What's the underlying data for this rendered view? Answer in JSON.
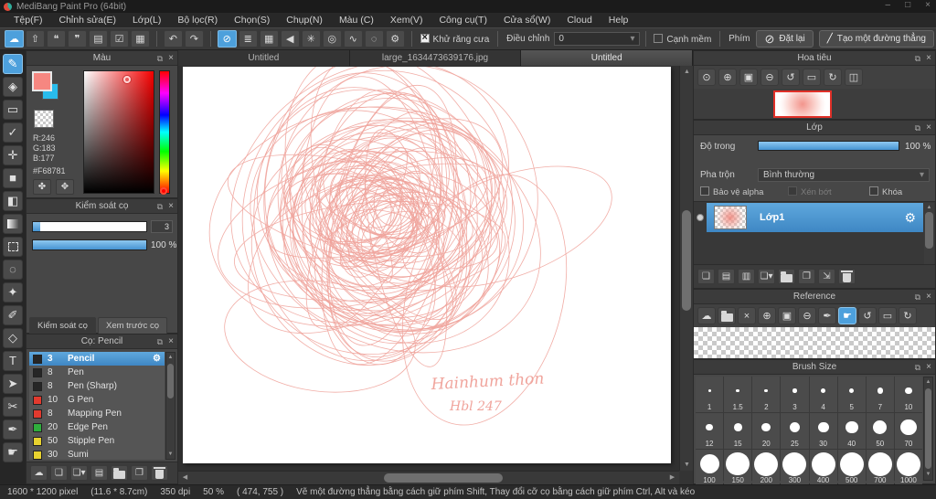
{
  "window": {
    "title": "MediBang Paint Pro (64bit)",
    "controls": {
      "minimize": "–",
      "maximize": "□",
      "close": "×"
    }
  },
  "menu": {
    "items": [
      "Tệp(F)",
      "Chỉnh sửa(E)",
      "Lớp(L)",
      "Bộ lọc(R)",
      "Chọn(S)",
      "Chụp(N)",
      "Màu (C)",
      "Xem(V)",
      "Công cụ(T)",
      "Cửa sổ(W)",
      "Cloud",
      "Help"
    ]
  },
  "toolbar": {
    "file_icons": [
      {
        "name": "cloud-icon",
        "glyph": "☁",
        "selected": true
      },
      {
        "name": "publish-icon",
        "glyph": "⇧"
      },
      {
        "name": "comment-icon",
        "glyph": "❝"
      },
      {
        "name": "chat-icon",
        "glyph": "❞"
      },
      {
        "name": "document-icon",
        "glyph": "▤"
      },
      {
        "name": "checklist-icon",
        "glyph": "☑"
      },
      {
        "name": "new-canvas-icon",
        "glyph": "▦"
      }
    ],
    "undo_icons": [
      {
        "name": "undo-icon",
        "glyph": "↶"
      },
      {
        "name": "redo-icon",
        "glyph": "↷"
      }
    ],
    "brushtip_icons": [
      {
        "name": "brushtip-none-icon",
        "glyph": "⊘",
        "selected": true
      },
      {
        "name": "brushtip-parallel-icon",
        "glyph": "≣"
      },
      {
        "name": "brushtip-mesh-icon",
        "glyph": "▦"
      },
      {
        "name": "brushtip-triangle-icon",
        "glyph": "◀"
      },
      {
        "name": "brushtip-radial-icon",
        "glyph": "✳"
      },
      {
        "name": "brushtip-concentric-icon",
        "glyph": "◎"
      },
      {
        "name": "brushtip-curve-icon",
        "glyph": "∿"
      },
      {
        "name": "brushtip-dashed-circle-icon",
        "glyph": "◌"
      },
      {
        "name": "brushtip-gear-icon",
        "glyph": "⚙"
      }
    ],
    "antialias_label": "Khử răng cưa",
    "adjust_label": "Điều chỉnh",
    "adjust_value": "0",
    "soft_edge_label": "Cạnh mềm",
    "key_label": "Phím",
    "reset_button": "Đặt lại",
    "line_button": "Tạo một đường thẳng"
  },
  "toolstrip": {
    "tools": [
      {
        "name": "brush-tool",
        "glyph": "✎",
        "selected": true
      },
      {
        "name": "eraser-tool",
        "glyph": "◈"
      },
      {
        "name": "shape-brush-tool",
        "glyph": "▭"
      },
      {
        "name": "dot-tool",
        "glyph": "✓"
      },
      {
        "name": "move-tool",
        "glyph": "✛"
      },
      {
        "name": "fill-rect-tool",
        "glyph": "■"
      },
      {
        "name": "bucket-tool",
        "glyph": "◧"
      },
      {
        "name": "gradient-tool",
        "shape": "gradient"
      },
      {
        "name": "select-tool",
        "shape": "dashed-box"
      },
      {
        "name": "lasso-tool",
        "glyph": "◌"
      },
      {
        "name": "magic-wand-tool",
        "glyph": "✦"
      },
      {
        "name": "select-pen-tool",
        "glyph": "✐"
      },
      {
        "name": "select-eraser-tool",
        "glyph": "◇"
      },
      {
        "name": "text-tool",
        "glyph": "T"
      },
      {
        "name": "operation-tool",
        "glyph": "➤"
      },
      {
        "name": "divide-tool",
        "glyph": "✂"
      },
      {
        "name": "eyedropper-tool",
        "glyph": "✒"
      },
      {
        "name": "hand-tool",
        "glyph": "☛"
      }
    ]
  },
  "color_panel": {
    "title": "Màu",
    "r_label": "R:246",
    "g_label": "G:183",
    "b_label": "B:177",
    "hex": "#F68781",
    "foreground_color": "#F68781",
    "background_color": "#29BCEC",
    "palette_icons": [
      {
        "name": "palette-icon",
        "glyph": "✤"
      },
      {
        "name": "palette-save-icon",
        "glyph": "✥"
      }
    ]
  },
  "brush_control": {
    "title": "Kiểm soát cọ",
    "size_value": "3",
    "opacity_value": "100 %",
    "tab_control": "Kiểm soát cọ",
    "tab_preview": "Xem trước cọ"
  },
  "brush_panel": {
    "title": "Cọ: Pencil",
    "brushes": [
      {
        "size": "3",
        "name": "Pencil",
        "swatch": "#262626",
        "selected": true
      },
      {
        "size": "8",
        "name": "Pen",
        "swatch": "#262626"
      },
      {
        "size": "8",
        "name": "Pen (Sharp)",
        "swatch": "#262626"
      },
      {
        "size": "10",
        "name": "G Pen",
        "swatch": "#e23a2e"
      },
      {
        "size": "8",
        "name": "Mapping Pen",
        "swatch": "#e23a2e"
      },
      {
        "size": "20",
        "name": "Edge Pen",
        "swatch": "#2fae3c"
      },
      {
        "size": "50",
        "name": "Stipple Pen",
        "swatch": "#e8d22f"
      },
      {
        "size": "30",
        "name": "Sumi",
        "swatch": "#e8d22f"
      }
    ],
    "footer_icons": [
      {
        "name": "cloud-brush-icon",
        "glyph": "☁"
      },
      {
        "name": "add-brush-icon",
        "glyph": "❏"
      },
      {
        "name": "add-brush-menu-icon",
        "glyph": "❏▾"
      },
      {
        "name": "brush-script-icon",
        "glyph": "▤"
      },
      {
        "name": "brush-folder-icon",
        "shape": "folder"
      },
      {
        "name": "duplicate-brush-icon",
        "glyph": "❐"
      },
      {
        "name": "delete-brush-icon",
        "shape": "trash"
      }
    ]
  },
  "tabs": [
    {
      "label": "Untitled",
      "active": false
    },
    {
      "label": "large_1634473639176.jpg",
      "active": false
    },
    {
      "label": "Untitled",
      "active": true
    }
  ],
  "canvas": {
    "stroke_color": "#f0a49c",
    "signature_line1": "Hainhum thon",
    "signature_line2": "Hbl 247"
  },
  "navigator": {
    "title": "Hoa tiêu",
    "icons": [
      {
        "name": "zoom-original-icon",
        "glyph": "⊙"
      },
      {
        "name": "zoom-in-icon",
        "glyph": "⊕"
      },
      {
        "name": "zoom-fit-icon",
        "glyph": "▣"
      },
      {
        "name": "zoom-out-icon",
        "glyph": "⊖"
      },
      {
        "name": "rotate-ccw-icon",
        "glyph": "↺"
      },
      {
        "name": "rotate-reset-icon",
        "glyph": "▭"
      },
      {
        "name": "rotate-cw-icon",
        "glyph": "↻"
      },
      {
        "name": "flip-icon",
        "glyph": "◫"
      }
    ]
  },
  "layer_panel": {
    "title": "Lớp",
    "opacity_label": "Độ trong",
    "opacity_value": "100 %",
    "blend_label": "Pha trộn",
    "blend_value": "Bình thường",
    "checkbox_alpha": "Bảo vệ alpha",
    "checkbox_clip": "Xén bớt",
    "checkbox_lock": "Khóa",
    "layers": [
      {
        "name": "Lớp1"
      }
    ],
    "footer_icons": [
      {
        "name": "add-layer-icon",
        "glyph": "❏"
      },
      {
        "name": "add-8bit-layer-icon",
        "glyph": "▤"
      },
      {
        "name": "add-1bit-layer-icon",
        "glyph": "▥"
      },
      {
        "name": "add-layer-menu-icon",
        "glyph": "❏▾"
      },
      {
        "name": "layer-folder-icon",
        "shape": "folder"
      },
      {
        "name": "duplicate-layer-icon",
        "glyph": "❐"
      },
      {
        "name": "merge-layer-icon",
        "glyph": "⇲"
      },
      {
        "name": "delete-layer-icon",
        "shape": "trash"
      }
    ]
  },
  "reference_panel": {
    "title": "Reference",
    "icons": [
      {
        "name": "ref-upload-icon",
        "glyph": "☁"
      },
      {
        "name": "ref-open-folder-icon",
        "shape": "folder"
      },
      {
        "name": "ref-clear-icon",
        "glyph": "×"
      },
      {
        "name": "ref-zoom-in-icon",
        "glyph": "⊕"
      },
      {
        "name": "ref-fit-icon",
        "glyph": "▣"
      },
      {
        "name": "ref-zoom-out-icon",
        "glyph": "⊖"
      },
      {
        "name": "ref-eyedropper-icon",
        "glyph": "✒"
      },
      {
        "name": "ref-hand-icon",
        "glyph": "☛",
        "selected": true
      },
      {
        "name": "ref-rotate-ccw-icon",
        "glyph": "↺"
      },
      {
        "name": "ref-rotate-reset-icon",
        "glyph": "▭"
      },
      {
        "name": "ref-rotate-cw-icon",
        "glyph": "↻"
      }
    ]
  },
  "brush_size_panel": {
    "title": "Brush Size",
    "sizes": [
      "1",
      "1.5",
      "2",
      "3",
      "4",
      "5",
      "7",
      "10",
      "12",
      "15",
      "20",
      "25",
      "30",
      "40",
      "50",
      "70",
      "100",
      "150",
      "200",
      "300",
      "400",
      "500",
      "700",
      "1000"
    ]
  },
  "status_bar": {
    "size": "1600 * 1200 pixel",
    "dimensions": "(11.6 * 8.7cm)",
    "dpi": "350 dpi",
    "zoom": "50 %",
    "coords": "( 474, 755 )",
    "hint": "Vẽ một đường thẳng bằng cách giữ phím Shift, Thay đổi cỡ cọ bằng cách giữ phím Ctrl, Alt và kéo"
  }
}
